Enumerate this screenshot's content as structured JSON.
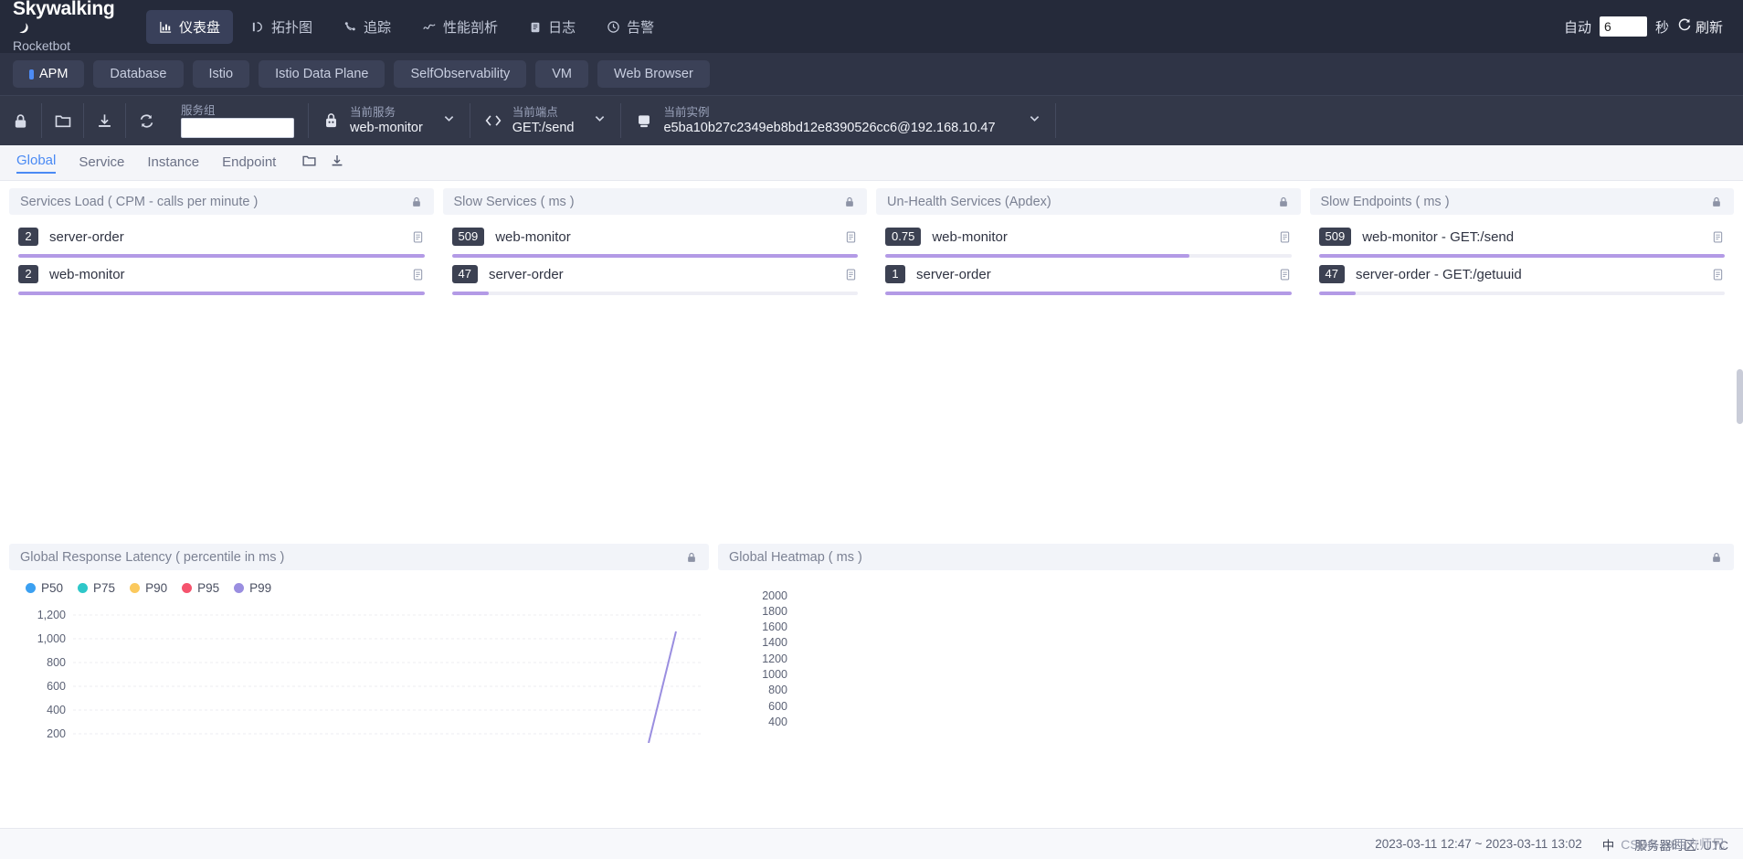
{
  "brand": {
    "line1": "Skywalking",
    "line2": "Rocketbot",
    "moon_icon": "moon-icon"
  },
  "topnav": {
    "items": [
      {
        "label": "仪表盘",
        "icon": "dashboard-chart-icon",
        "active": true
      },
      {
        "label": "拓扑图",
        "icon": "topology-icon",
        "active": false
      },
      {
        "label": "追踪",
        "icon": "trace-icon",
        "active": false
      },
      {
        "label": "性能剖析",
        "icon": "profiling-wave-icon",
        "active": false
      },
      {
        "label": "日志",
        "icon": "log-clipboard-icon",
        "active": false
      },
      {
        "label": "告警",
        "icon": "alarm-clock-icon",
        "active": false
      }
    ],
    "auto_label": "自动",
    "auto_value": "6",
    "seconds_label": "秒",
    "refresh_label": "刷新",
    "refresh_icon": "refresh-icon"
  },
  "dashboard_tabs": [
    {
      "label": "APM",
      "active": true
    },
    {
      "label": "Database",
      "active": false
    },
    {
      "label": "Istio",
      "active": false
    },
    {
      "label": "Istio Data Plane",
      "active": false
    },
    {
      "label": "SelfObservability",
      "active": false
    },
    {
      "label": "VM",
      "active": false
    },
    {
      "label": "Web Browser",
      "active": false
    }
  ],
  "selector_bar": {
    "icons": [
      "lock-icon",
      "folder-icon",
      "download-icon",
      "sync-refresh-icon"
    ],
    "service_group": {
      "label": "服务组",
      "value": "",
      "placeholder": ""
    },
    "current_service": {
      "label": "当前服务",
      "value": "web-monitor",
      "icon": "service-icon"
    },
    "current_endpoint": {
      "label": "当前端点",
      "value": "GET:/send",
      "icon": "code-brackets-icon"
    },
    "current_instance": {
      "label": "当前实例",
      "value": "e5ba10b27c2349eb8bd12e8390526cc6@192.168.10.47",
      "icon": "instance-server-icon"
    }
  },
  "sub_tabs": {
    "items": [
      {
        "label": "Global",
        "active": true
      },
      {
        "label": "Service",
        "active": false
      },
      {
        "label": "Instance",
        "active": false
      },
      {
        "label": "Endpoint",
        "active": false
      }
    ],
    "icons": [
      "folder-icon",
      "download-icon"
    ]
  },
  "cards": [
    {
      "title": "Services Load ( CPM - calls per minute )",
      "lock_icon": "lock-icon",
      "rows": [
        {
          "value": "2",
          "name": "server-order",
          "percent": 100,
          "copy_icon": "copy-icon"
        },
        {
          "value": "2",
          "name": "web-monitor",
          "percent": 100,
          "copy_icon": "copy-icon"
        }
      ]
    },
    {
      "title": "Slow Services ( ms )",
      "lock_icon": "lock-icon",
      "rows": [
        {
          "value": "509",
          "name": "web-monitor",
          "percent": 100,
          "copy_icon": "copy-icon"
        },
        {
          "value": "47",
          "name": "server-order",
          "percent": 9,
          "copy_icon": "copy-icon"
        }
      ]
    },
    {
      "title": "Un-Health Services (Apdex)",
      "lock_icon": "lock-icon",
      "rows": [
        {
          "value": "0.75",
          "name": "web-monitor",
          "percent": 75,
          "copy_icon": "copy-icon"
        },
        {
          "value": "1",
          "name": "server-order",
          "percent": 100,
          "copy_icon": "copy-icon"
        }
      ]
    },
    {
      "title": "Slow Endpoints ( ms )",
      "lock_icon": "lock-icon",
      "rows": [
        {
          "value": "509",
          "name": "web-monitor - GET:/send",
          "percent": 100,
          "copy_icon": "copy-icon"
        },
        {
          "value": "47",
          "name": "server-order - GET:/getuuid",
          "percent": 9,
          "copy_icon": "copy-icon"
        }
      ]
    }
  ],
  "chart_data": [
    {
      "type": "line",
      "title": "Global Response Latency ( percentile in ms )",
      "lock_icon": "lock-icon",
      "xlabel": "",
      "ylabel": "",
      "ylim": [
        200,
        1200
      ],
      "yticks": [
        "1,200",
        "1,000",
        "800",
        "600",
        "400",
        "200"
      ],
      "grid": true,
      "legend_position": "top-left",
      "legend": [
        {
          "name": "P50",
          "color": "#3ba0f1"
        },
        {
          "name": "P75",
          "color": "#2ec7c9"
        },
        {
          "name": "P90",
          "color": "#fbc95d"
        },
        {
          "name": "P95",
          "color": "#f5536d"
        },
        {
          "name": "P99",
          "color": "#9a8ee0"
        }
      ],
      "series": [
        {
          "name": "P50",
          "color": "#3ba0f1",
          "values": [
            0,
            0,
            0,
            0,
            0,
            0,
            0,
            0,
            0,
            0,
            0,
            0
          ]
        },
        {
          "name": "P75",
          "color": "#2ec7c9",
          "values": [
            0,
            0,
            0,
            0,
            0,
            0,
            0,
            0,
            0,
            0,
            0,
            0
          ]
        },
        {
          "name": "P90",
          "color": "#fbc95d",
          "values": [
            0,
            0,
            0,
            0,
            0,
            0,
            0,
            0,
            0,
            0,
            0,
            0
          ]
        },
        {
          "name": "P95",
          "color": "#f5536d",
          "values": [
            0,
            0,
            0,
            0,
            0,
            0,
            0,
            0,
            0,
            0,
            0,
            0
          ]
        },
        {
          "name": "P99",
          "color": "#9a8ee0",
          "values": [
            0,
            0,
            0,
            0,
            0,
            0,
            0,
            0,
            0,
            200,
            1050,
            0
          ]
        }
      ]
    },
    {
      "type": "heatmap",
      "title": "Global Heatmap ( ms )",
      "lock_icon": "lock-icon",
      "xlabel": "",
      "ylabel": "",
      "yticks": [
        "2000",
        "1800",
        "1600",
        "1400",
        "1200",
        "1000",
        "800",
        "600",
        "400"
      ],
      "values": []
    }
  ],
  "status_bar": {
    "time_range": "2023-03-11 12:47 ~ 2023-03-11 13:02",
    "lang": "中",
    "right_text": "服务器时区: UTC",
    "watermark": "CSDN @西方师兄"
  }
}
